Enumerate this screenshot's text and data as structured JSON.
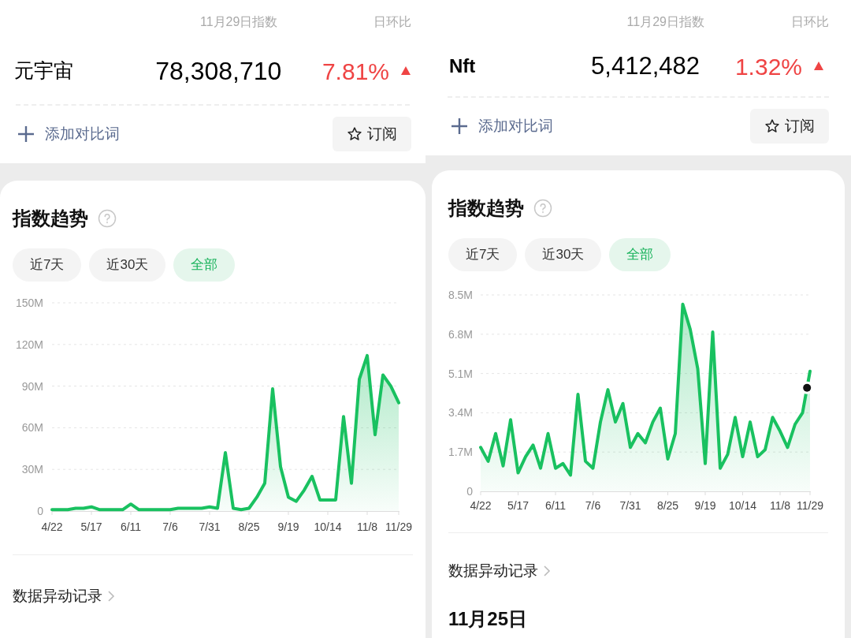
{
  "panels": [
    {
      "header": {
        "date_label": "11月29日指数",
        "change_label": "日环比"
      },
      "keyword": "元宇宙",
      "index_value": "78,308,710",
      "change": "7.81%",
      "rising": true,
      "add_compare": "添加对比词",
      "subscribe": "订阅",
      "trend": {
        "title": "指数趋势",
        "ranges": [
          {
            "label": "近7天",
            "selected": false
          },
          {
            "label": "近30天",
            "selected": false
          },
          {
            "label": "全部",
            "selected": true
          }
        ],
        "chart_data": {
          "type": "area",
          "grid": true,
          "ylim": [
            0,
            150
          ],
          "categories": [
            "4/22",
            null,
            null,
            null,
            null,
            "5/17",
            null,
            null,
            null,
            null,
            "6/11",
            null,
            null,
            null,
            null,
            "7/6",
            null,
            null,
            null,
            null,
            "7/31",
            null,
            null,
            null,
            null,
            "8/25",
            null,
            null,
            null,
            null,
            "9/19",
            null,
            null,
            null,
            null,
            "10/14",
            null,
            null,
            null,
            null,
            "11/8",
            null,
            null,
            null,
            "11/29"
          ],
          "yticks": [
            {
              "value": 0,
              "label": "0"
            },
            {
              "value": 30,
              "label": "30M"
            },
            {
              "value": 60,
              "label": "60M"
            },
            {
              "value": 90,
              "label": "90M"
            },
            {
              "value": 120,
              "label": "120M"
            },
            {
              "value": 150,
              "label": "150M"
            }
          ],
          "series": [
            {
              "color": "#19c160",
              "values": [
                1,
                1,
                1,
                2,
                2,
                3,
                1,
                1,
                1,
                1,
                5,
                1,
                1,
                1,
                1,
                1,
                2,
                2,
                2,
                2,
                3,
                2,
                42,
                2,
                1,
                2,
                10,
                20,
                88,
                32,
                10,
                7,
                15,
                25,
                8,
                8,
                8,
                68,
                20,
                95,
                112,
                55,
                98,
                90,
                78
              ]
            }
          ]
        }
      },
      "records": {
        "title": "数据异动记录"
      }
    },
    {
      "header": {
        "date_label": "11月29日指数",
        "change_label": "日环比"
      },
      "keyword": "Nft",
      "index_value": "5,412,482",
      "change": "1.32%",
      "rising": true,
      "add_compare": "添加对比词",
      "subscribe": "订阅",
      "trend": {
        "title": "指数趋势",
        "hover_marker": true,
        "ranges": [
          {
            "label": "近7天",
            "selected": false
          },
          {
            "label": "近30天",
            "selected": false
          },
          {
            "label": "全部",
            "selected": true
          }
        ],
        "chart_data": {
          "type": "area",
          "grid": true,
          "ylim": [
            0,
            8.5
          ],
          "categories": [
            "4/22",
            null,
            null,
            null,
            null,
            "5/17",
            null,
            null,
            null,
            null,
            "6/11",
            null,
            null,
            null,
            null,
            "7/6",
            null,
            null,
            null,
            null,
            "7/31",
            null,
            null,
            null,
            null,
            "8/25",
            null,
            null,
            null,
            null,
            "9/19",
            null,
            null,
            null,
            null,
            "10/14",
            null,
            null,
            null,
            null,
            "11/8",
            null,
            null,
            null,
            "11/29"
          ],
          "yticks": [
            {
              "value": 0,
              "label": "0"
            },
            {
              "value": 1.7,
              "label": "1.7M"
            },
            {
              "value": 3.4,
              "label": "3.4M"
            },
            {
              "value": 5.1,
              "label": "5.1M"
            },
            {
              "value": 6.8,
              "label": "6.8M"
            },
            {
              "value": 8.5,
              "label": "8.5M"
            }
          ],
          "series": [
            {
              "color": "#19c160",
              "values": [
                1.9,
                1.3,
                2.5,
                1.1,
                3.1,
                0.8,
                1.5,
                2.0,
                1.0,
                2.5,
                1.0,
                1.2,
                0.7,
                4.2,
                1.3,
                1.0,
                3.0,
                4.4,
                3.0,
                3.8,
                1.9,
                2.5,
                2.1,
                3.0,
                3.6,
                1.4,
                2.5,
                8.1,
                7.0,
                5.3,
                1.2,
                6.9,
                1.0,
                1.6,
                3.2,
                1.5,
                3.0,
                1.5,
                1.8,
                3.2,
                2.6,
                1.9,
                2.9,
                3.4,
                5.2
              ]
            }
          ]
        }
      },
      "records": {
        "title": "数据异动记录",
        "date": "11月25日"
      }
    }
  ]
}
